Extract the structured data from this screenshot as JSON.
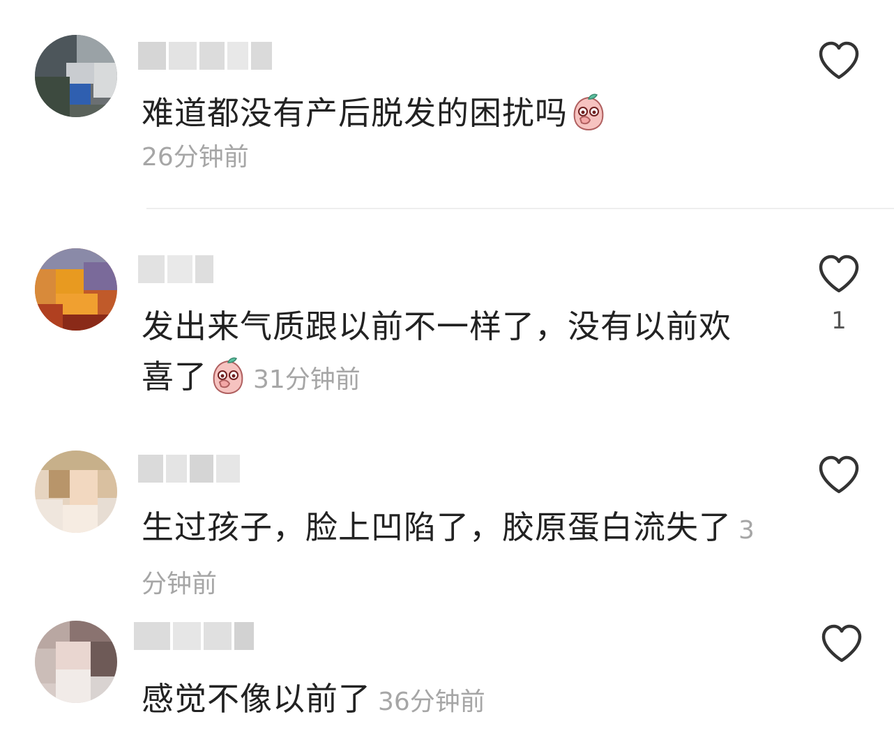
{
  "comments": [
    {
      "text": "难道都没有产后脱发的困扰吗",
      "emoji": "peach-cover-mouth-emoji",
      "time": "26分钟前",
      "like_count": ""
    },
    {
      "text": "发出来气质跟以前不一样了，没有以前欢喜了",
      "emoji": "peach-cover-mouth-emoji",
      "time": "31分钟前",
      "like_count": "1"
    },
    {
      "text": "生过孩子，脸上凹陷了，胶原蛋白流失了",
      "time": "3分钟前",
      "like_count": ""
    },
    {
      "text": "感觉不像以前了",
      "time": "36分钟前",
      "like_count": ""
    }
  ],
  "colors": {
    "text": "#222222",
    "meta": "#a6a6a6",
    "icon": "#333333",
    "divider": "#eeeeee"
  }
}
